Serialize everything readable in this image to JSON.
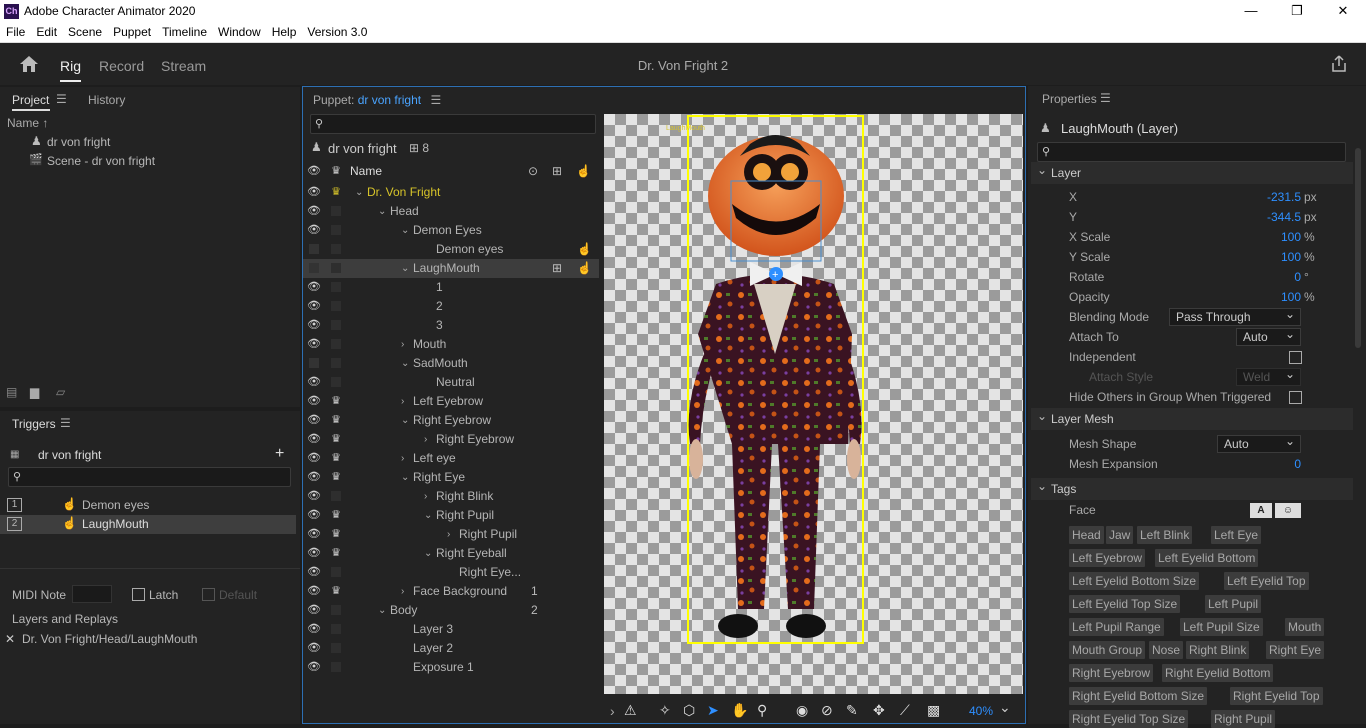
{
  "window": {
    "app_title": "Adobe Character Animator 2020",
    "app_icon": "Ch",
    "minimize": "—",
    "maximize": "❐",
    "close": "✕"
  },
  "menu": [
    "File",
    "Edit",
    "Scene",
    "Puppet",
    "Timeline",
    "Window",
    "Help",
    "Version 3.0"
  ],
  "topbar": {
    "tabs": [
      "Rig",
      "Record",
      "Stream"
    ],
    "active_tab": "Rig",
    "document_title": "Dr. Von Fright 2"
  },
  "project_panel": {
    "tabs": [
      "Project",
      "History"
    ],
    "column_name": "Name ↑",
    "items": [
      "dr von fright",
      "Scene - dr von fright"
    ]
  },
  "triggers_panel": {
    "title": "Triggers",
    "puppet": "dr von fright",
    "add": "+",
    "items": [
      {
        "key": "1",
        "name": "Demon eyes"
      },
      {
        "key": "2",
        "name": "LaughMouth"
      }
    ],
    "midi_note_label": "MIDI Note",
    "latch_label": "Latch",
    "default_label": "Default",
    "layers_title": "Layers and Replays",
    "layer_path": "Dr. Von Fright/Head/LaughMouth",
    "remove": "✕"
  },
  "puppet_panel": {
    "title_prefix": "Puppet:",
    "puppet_name": "dr von fright",
    "header_name": "dr von fright",
    "count": "8",
    "column_name": "Name",
    "rows": [
      {
        "label": "Dr. Von Fright",
        "depth": 0,
        "chev": "⌄",
        "eye": true,
        "crown": true,
        "accent": true
      },
      {
        "label": "Head",
        "depth": 1,
        "chev": "⌄",
        "eye": true
      },
      {
        "label": "Demon Eyes",
        "depth": 2,
        "chev": "⌄",
        "eye": true
      },
      {
        "label": "Demon eyes",
        "depth": 3,
        "chev": "",
        "eye": false,
        "handle": true
      },
      {
        "label": "LaughMouth",
        "depth": 2,
        "chev": "⌄",
        "eye": false,
        "selected": true,
        "trigger": true,
        "handle": true
      },
      {
        "label": "1",
        "depth": 3,
        "chev": "",
        "eye": true
      },
      {
        "label": "2",
        "depth": 3,
        "chev": "",
        "eye": true
      },
      {
        "label": "3",
        "depth": 3,
        "chev": "",
        "eye": true
      },
      {
        "label": "Mouth",
        "depth": 2,
        "chev": "›",
        "eye": true
      },
      {
        "label": "SadMouth",
        "depth": 2,
        "chev": "⌄",
        "eye": false
      },
      {
        "label": "Neutral",
        "depth": 3,
        "chev": "",
        "eye": true
      },
      {
        "label": "Left Eyebrow",
        "depth": 2,
        "chev": "›",
        "eye": true,
        "crown": true
      },
      {
        "label": "Right Eyebrow",
        "depth": 2,
        "chev": "⌄",
        "eye": true,
        "crown": true
      },
      {
        "label": "Right Eyebrow",
        "depth": 3,
        "chev": "›",
        "eye": true,
        "crown": true
      },
      {
        "label": "Left eye",
        "depth": 2,
        "chev": "›",
        "eye": true,
        "crown": true
      },
      {
        "label": "Right Eye",
        "depth": 2,
        "chev": "⌄",
        "eye": true,
        "crown": true
      },
      {
        "label": "Right Blink",
        "depth": 3,
        "chev": "›",
        "eye": true
      },
      {
        "label": "Right Pupil",
        "depth": 3,
        "chev": "⌄",
        "eye": true,
        "crown": true
      },
      {
        "label": "Right Pupil",
        "depth": 4,
        "chev": "›",
        "eye": true,
        "crown": true
      },
      {
        "label": "Right Eyeball",
        "depth": 3,
        "chev": "⌄",
        "eye": true,
        "crown": true
      },
      {
        "label": "Right Eye...",
        "depth": 4,
        "chev": "",
        "eye": true
      },
      {
        "label": "Face Background",
        "depth": 2,
        "chev": "›",
        "eye": true,
        "crown": true,
        "num": "1"
      },
      {
        "label": "Body",
        "depth": 1,
        "chev": "⌄",
        "eye": true,
        "num": "2"
      },
      {
        "label": "Layer 3",
        "depth": 2,
        "chev": "",
        "eye": true
      },
      {
        "label": "Layer 2",
        "depth": 2,
        "chev": "",
        "eye": true
      },
      {
        "label": "Exposure 1",
        "depth": 2,
        "chev": "",
        "eye": true
      }
    ]
  },
  "canvas": {
    "zoom": "40%",
    "layer_tag": "LaughMouth"
  },
  "properties": {
    "title": "Properties",
    "layer_title": "LaughMouth (Layer)",
    "sections": {
      "layer": "Layer",
      "mesh": "Layer Mesh",
      "tags": "Tags"
    },
    "x": {
      "label": "X",
      "value": "-231.5",
      "unit": "px"
    },
    "y": {
      "label": "Y",
      "value": "-344.5",
      "unit": "px"
    },
    "xscale": {
      "label": "X Scale",
      "value": "100",
      "unit": "%"
    },
    "yscale": {
      "label": "Y Scale",
      "value": "100",
      "unit": "%"
    },
    "rotate": {
      "label": "Rotate",
      "value": "0",
      "unit": "°"
    },
    "opacity": {
      "label": "Opacity",
      "value": "100",
      "unit": "%"
    },
    "blending": {
      "label": "Blending Mode",
      "value": "Pass Through"
    },
    "attach_to": {
      "label": "Attach To",
      "value": "Auto"
    },
    "independent": {
      "label": "Independent"
    },
    "attach_style": {
      "label": "Attach Style",
      "value": "Weld"
    },
    "hide_others": {
      "label": "Hide Others in Group When Triggered"
    },
    "mesh_shape": {
      "label": "Mesh Shape",
      "value": "Auto"
    },
    "mesh_expansion": {
      "label": "Mesh Expansion",
      "value": "0"
    },
    "face_label": "Face",
    "tag_rows": [
      [
        "Head",
        "Jaw",
        "Left Blink",
        "Left Eye"
      ],
      [
        "Left Eyebrow",
        "Left Eyelid Bottom"
      ],
      [
        "Left Eyelid Bottom Size",
        "Left Eyelid Top"
      ],
      [
        "Left Eyelid Top Size",
        "Left Pupil"
      ],
      [
        "Left Pupil Range",
        "Left Pupil Size",
        "Mouth"
      ],
      [
        "Mouth Group",
        "Nose",
        "Right Blink",
        "Right Eye"
      ],
      [
        "Right Eyebrow",
        "Right Eyelid Bottom"
      ],
      [
        "Right Eyelid Bottom Size",
        "Right Eyelid Top"
      ],
      [
        "Right Eyelid Top Size",
        "Right Pupil"
      ]
    ]
  },
  "colors": {
    "accent": "#2e8fff",
    "selection_yellow": "#ffff00",
    "panel": "#232323",
    "gold": "#d7c42a"
  }
}
